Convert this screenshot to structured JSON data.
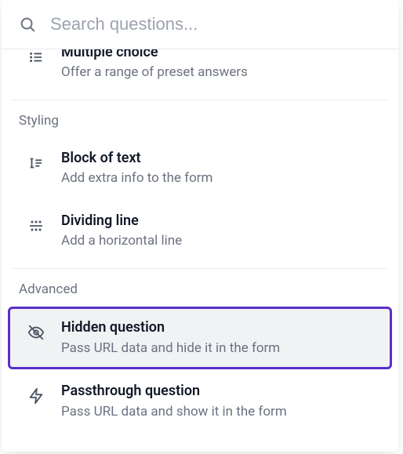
{
  "search": {
    "placeholder": "Search questions..."
  },
  "sections": {
    "styling_label": "Styling",
    "advanced_label": "Advanced"
  },
  "items": {
    "multiple_choice": {
      "title": "Multiple choice",
      "desc": "Offer a range of preset answers"
    },
    "block_of_text": {
      "title": "Block of text",
      "desc": "Add extra info to the form"
    },
    "dividing_line": {
      "title": "Dividing line",
      "desc": "Add a horizontal line"
    },
    "hidden_question": {
      "title": "Hidden question",
      "desc": "Pass URL data and hide it in the form"
    },
    "passthrough_question": {
      "title": "Passthrough question",
      "desc": "Pass URL data and show it in the form"
    }
  }
}
